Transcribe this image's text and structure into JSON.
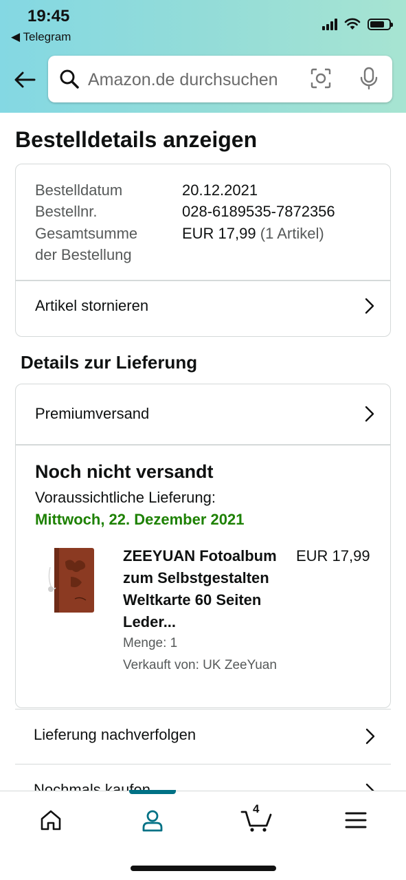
{
  "status_bar": {
    "time": "19:45",
    "back_app": "◀ Telegram"
  },
  "search": {
    "placeholder": "Amazon.de durchsuchen"
  },
  "page": {
    "title": "Bestelldetails anzeigen"
  },
  "order_summary": {
    "rows": [
      {
        "label": "Bestelldatum",
        "value": "20.12.2021"
      },
      {
        "label": "Bestellnr.",
        "value": "028-6189535-7872356"
      },
      {
        "label": "Gesamtsumme",
        "value": "EUR 17,99"
      },
      {
        "label": "der Bestellung"
      }
    ],
    "item_count": "(1 Artikel)",
    "cancel_label": "Artikel stornieren"
  },
  "delivery": {
    "section_title": "Details zur Lieferung",
    "shipping_method": "Premiumversand",
    "status": "Noch nicht versandt",
    "expected_label": "Voraussichtliche Lieferung:",
    "expected_date": "Mittwoch, 22. Dezember 2021",
    "expected_date_color": "#1d8102",
    "product": {
      "title_lines": [
        "ZEEYUAN Fotoalbum",
        "zum Selbstgestalten",
        "Weltkarte 60 Seiten",
        "Leder..."
      ],
      "price": "EUR 17,99",
      "quantity": "Menge: 1",
      "seller": "Verkauft von: UK ZeeYuan"
    }
  },
  "actions": {
    "track": "Lieferung nachverfolgen",
    "buy_again": "Nochmals kaufen"
  },
  "bottom_nav": {
    "items": [
      "home-icon",
      "account-icon",
      "cart-icon",
      "menu-icon"
    ],
    "cart_count": "4",
    "active_color": "#007185"
  }
}
